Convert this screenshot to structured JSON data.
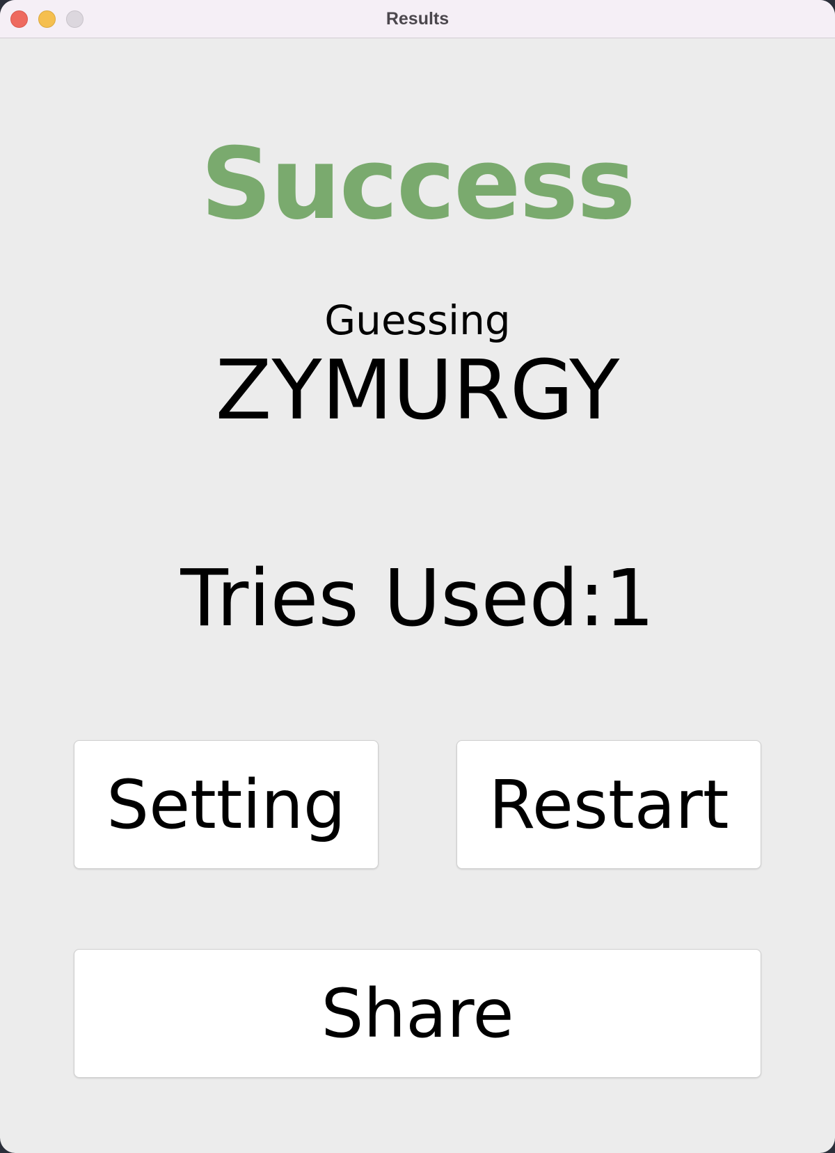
{
  "window": {
    "title": "Results"
  },
  "result": {
    "status": "Success",
    "status_color": "#7aaa6e",
    "guessing_label": "Guessing",
    "word": "ZYMURGY",
    "tries_text": "Tries Used:1"
  },
  "buttons": {
    "setting_label": "Setting",
    "restart_label": "Restart",
    "share_label": "Share"
  }
}
